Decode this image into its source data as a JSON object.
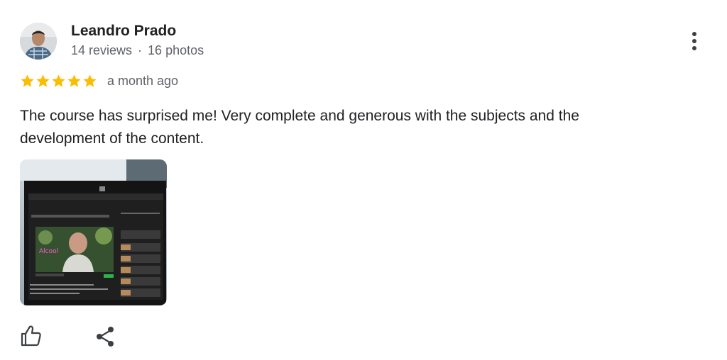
{
  "reviewer": {
    "name": "Leandro Prado",
    "reviews": "14 reviews",
    "separator": "·",
    "photos": "16 photos",
    "avatar_icon": "person-avatar"
  },
  "review": {
    "rating": 5,
    "rating_max": 5,
    "star_color": "#fbbc04",
    "time": "a month ago",
    "text": "The course has surprised me! Very complete and generous with the subjects and the development of the content.",
    "photo_label": "Review photo: laptop screen showing an online course video lesson"
  },
  "actions": {
    "like_icon": "thumbs-up-icon",
    "share_icon": "share-icon",
    "more_icon": "more-vertical-icon"
  }
}
